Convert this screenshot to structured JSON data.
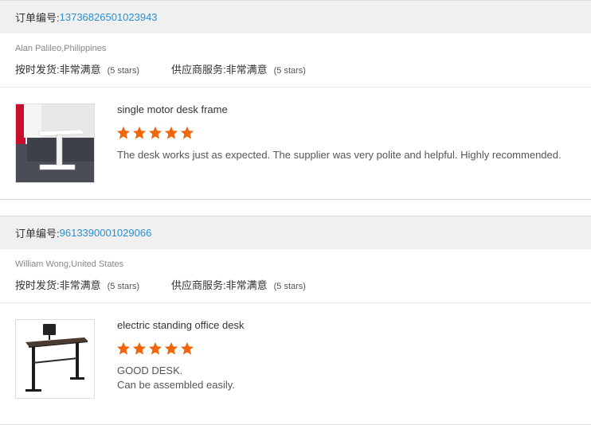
{
  "labels": {
    "order_no": "订单编号:",
    "on_time_delivery": "按时发货:",
    "supplier_service": "供应商服务:"
  },
  "star_color": "#f0660a",
  "reviews": [
    {
      "order_number": "13736826501023943",
      "buyer": "Alan Palileo,Philippines",
      "delivery_rating": "非常满意",
      "delivery_stars": "(5 stars)",
      "service_rating": "非常满意",
      "service_stars": "(5 stars)",
      "product_title": "single motor desk frame",
      "stars": 5,
      "feedback": "The desk works just as expected. The supplier was very polite and helpful. Highly recommended."
    },
    {
      "order_number": "9613390001029066",
      "buyer": "William Wong,United States",
      "delivery_rating": "非常满意",
      "delivery_stars": "(5 stars)",
      "service_rating": "非常满意",
      "service_stars": "(5 stars)",
      "product_title": "electric standing office desk",
      "stars": 5,
      "feedback": "GOOD DESK.\nCan be assembled easily."
    }
  ]
}
